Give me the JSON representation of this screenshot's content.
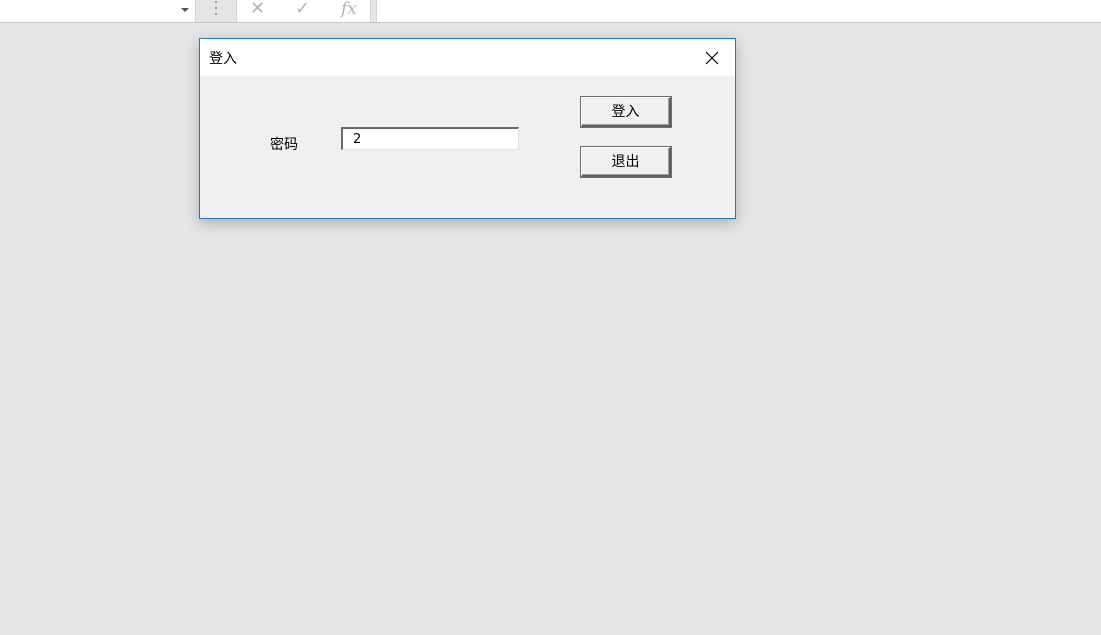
{
  "formula_bar": {
    "name_box_value": "",
    "cancel_icon": "✕",
    "enter_icon": "✓",
    "fx_label": "fx",
    "formula_value": ""
  },
  "dialog": {
    "title": "登入",
    "close_icon": "close-icon",
    "password_label": "密码",
    "password_value": "2",
    "login_button": "登入",
    "exit_button": "退出"
  },
  "colors": {
    "background": "#e6e6e6",
    "dialog_border": "#1979ca",
    "dialog_body": "#f0f0f0"
  }
}
